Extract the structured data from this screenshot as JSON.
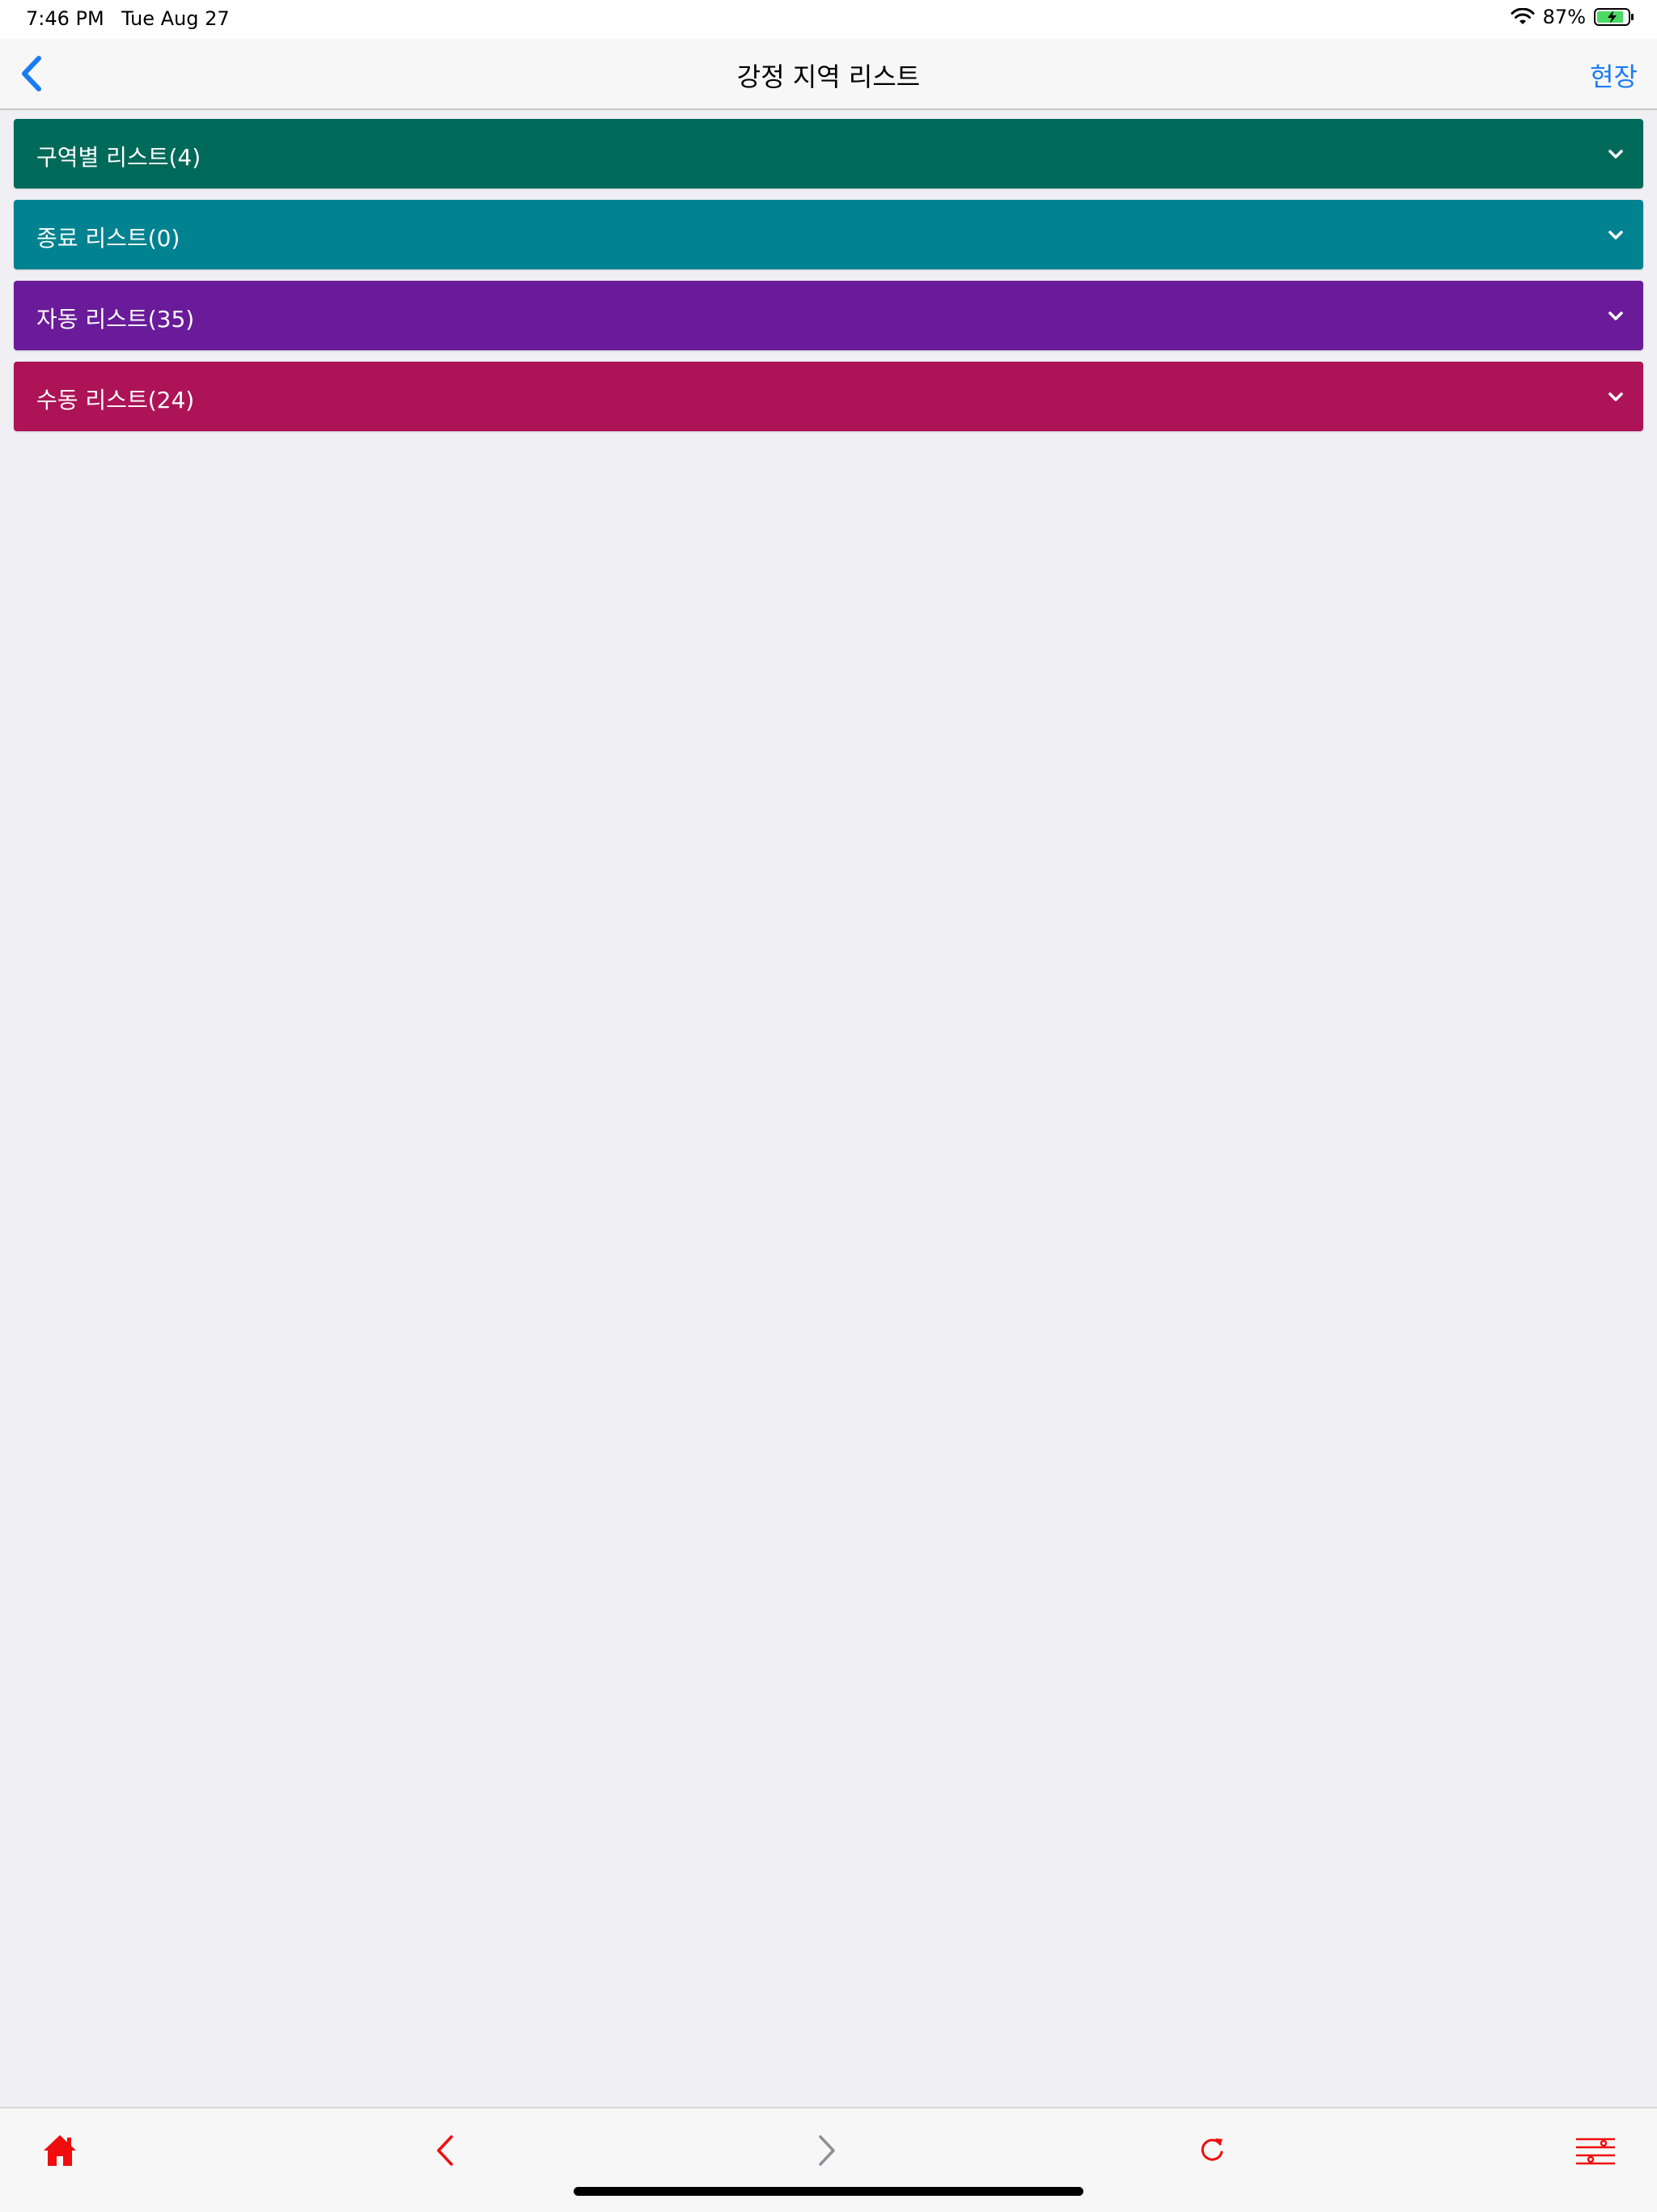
{
  "status_bar": {
    "time": "7:46 PM",
    "date": "Tue Aug 27",
    "battery_percent": "87%",
    "battery_level": 0.87
  },
  "nav": {
    "title": "강정 지역 리스트",
    "right_button": "현장",
    "back_icon": "chevron-left-icon"
  },
  "sections": [
    {
      "label": "구역별 리스트(4)",
      "color": "#006a5a"
    },
    {
      "label": "종료 리스트(0)",
      "color": "#008290"
    },
    {
      "label": "자동 리스트(35)",
      "color": "#6a1b9a"
    },
    {
      "label": "수동 리스트(24)",
      "color": "#ad1457"
    }
  ],
  "toolbar": {
    "items": [
      "home-icon",
      "back-arrow-icon",
      "forward-arrow-icon",
      "refresh-icon",
      "settings-sliders-icon"
    ],
    "accent_color": "#f00d0d",
    "disabled_color": "#8e8e93"
  }
}
